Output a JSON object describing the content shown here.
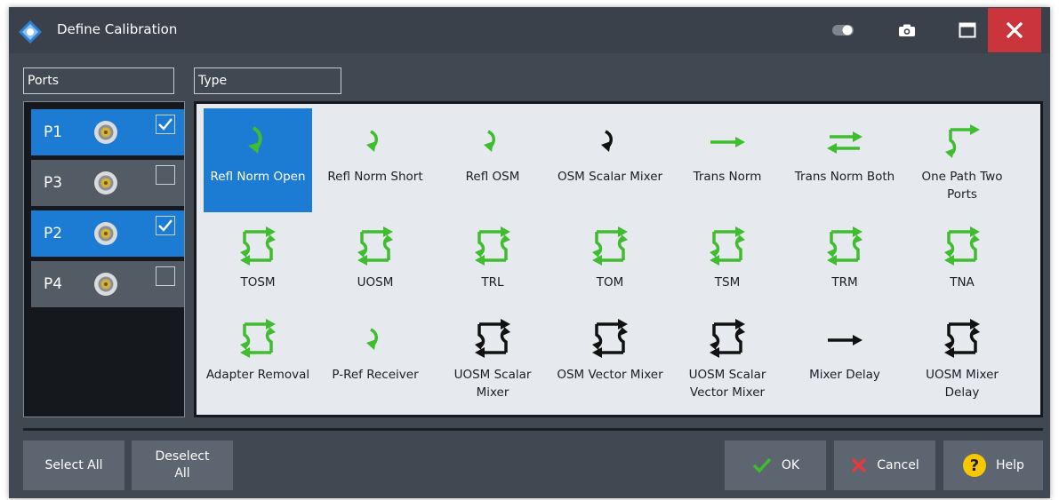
{
  "window": {
    "title": "Define Calibration"
  },
  "titlebar": {
    "icons": [
      "toggle-icon",
      "camera-icon",
      "maximize-icon",
      "close-icon"
    ],
    "close_color": "#c9353a"
  },
  "ports": {
    "label": "Ports",
    "items": [
      {
        "name": "P1",
        "checked": true
      },
      {
        "name": "P3",
        "checked": false
      },
      {
        "name": "P2",
        "checked": true
      },
      {
        "name": "P4",
        "checked": false
      }
    ]
  },
  "types": {
    "label": "Type",
    "selected": "Refl Norm Open",
    "items": [
      {
        "label": "Refl Norm Open",
        "icon": "refl-norm-open-icon"
      },
      {
        "label": "Refl Norm Short",
        "icon": "refl-norm-short-icon"
      },
      {
        "label": "Refl OSM",
        "icon": "refl-osm-icon"
      },
      {
        "label": "OSM Scalar Mixer",
        "icon": "osm-scalar-mixer-icon"
      },
      {
        "label": "Trans Norm",
        "icon": "trans-norm-icon"
      },
      {
        "label": "Trans Norm Both",
        "icon": "trans-norm-both-icon"
      },
      {
        "label": "One Path Two Ports",
        "icon": "one-path-two-ports-icon"
      },
      {
        "label": "TOSM",
        "icon": "tosm-icon"
      },
      {
        "label": "UOSM",
        "icon": "uosm-icon"
      },
      {
        "label": "TRL",
        "icon": "trl-icon"
      },
      {
        "label": "TOM",
        "icon": "tom-icon"
      },
      {
        "label": "TSM",
        "icon": "tsm-icon"
      },
      {
        "label": "TRM",
        "icon": "trm-icon"
      },
      {
        "label": "TNA",
        "icon": "tna-icon"
      },
      {
        "label": "Adapter Removal",
        "icon": "adapter-removal-icon"
      },
      {
        "label": "P-Ref Receiver",
        "icon": "p-ref-receiver-icon"
      },
      {
        "label": "UOSM Scalar Mixer",
        "icon": "uosm-scalar-mixer-icon"
      },
      {
        "label": "OSM Vector Mixer",
        "icon": "osm-vector-mixer-icon"
      },
      {
        "label": "UOSM Scalar Vector Mixer",
        "icon": "uosm-scalar-vector-mixer-icon"
      },
      {
        "label": "Mixer Delay",
        "icon": "mixer-delay-icon"
      },
      {
        "label": "UOSM Mixer Delay",
        "icon": "uosm-mixer-delay-icon"
      }
    ]
  },
  "buttons": {
    "select_all": "Select All",
    "deselect_all": "Deselect All",
    "ok": "OK",
    "cancel": "Cancel",
    "help": "Help"
  },
  "colors": {
    "accent": "#1c7bd2",
    "green": "#3ebd2e",
    "dialog_bg": "#404852",
    "button_bg": "#5d6670"
  }
}
